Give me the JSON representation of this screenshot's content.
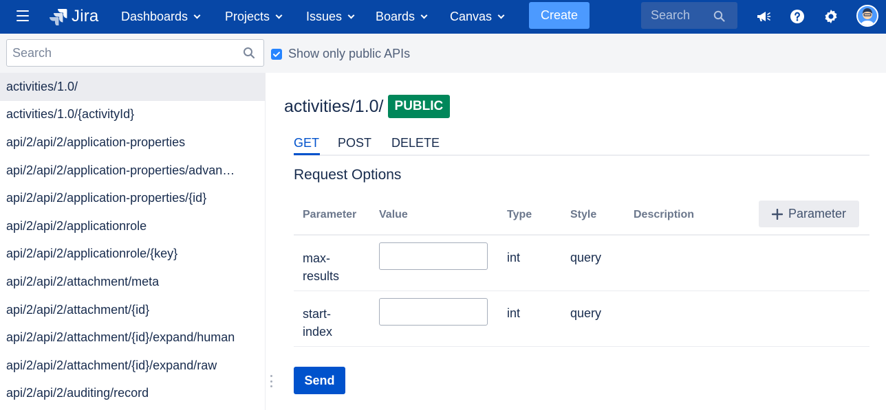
{
  "topnav": {
    "app_name": "Jira",
    "items": [
      {
        "label": "Dashboards"
      },
      {
        "label": "Projects"
      },
      {
        "label": "Issues"
      },
      {
        "label": "Boards"
      },
      {
        "label": "Canvas"
      }
    ],
    "create_label": "Create",
    "search_placeholder": "Search",
    "icons": [
      "menu-icon",
      "jira-logo-icon",
      "megaphone-icon",
      "help-icon",
      "settings-icon",
      "avatar"
    ],
    "colors": {
      "bar": "#0747a6",
      "create": "#4c9aff"
    }
  },
  "subbar": {
    "search_placeholder": "Search",
    "checkbox_label": "Show only public APIs",
    "checkbox_checked": true
  },
  "sidebar": {
    "items": [
      {
        "label": "activities/1.0/"
      },
      {
        "label": "activities/1.0/{activityId}"
      },
      {
        "label": "api/2/api/2/application-properties"
      },
      {
        "label": "api/2/api/2/application-properties/advan…"
      },
      {
        "label": "api/2/api/2/application-properties/{id}"
      },
      {
        "label": "api/2/api/2/applicationrole"
      },
      {
        "label": "api/2/api/2/applicationrole/{key}"
      },
      {
        "label": "api/2/api/2/attachment/meta"
      },
      {
        "label": "api/2/api/2/attachment/{id}"
      },
      {
        "label": "api/2/api/2/attachment/{id}/expand/human"
      },
      {
        "label": "api/2/api/2/attachment/{id}/expand/raw"
      },
      {
        "label": "api/2/api/2/auditing/record"
      }
    ],
    "active_index": 0
  },
  "main": {
    "title": "activities/1.0/",
    "badge": "PUBLIC",
    "badge_color": "#00875a",
    "tabs": [
      {
        "label": "GET"
      },
      {
        "label": "POST"
      },
      {
        "label": "DELETE"
      }
    ],
    "active_tab": 0,
    "section_title": "Request Options",
    "table": {
      "headers": [
        "Parameter",
        "Value",
        "Type",
        "Style",
        "Description"
      ],
      "add_parameter_label": "Parameter",
      "rows": [
        {
          "name": "max-results",
          "value": "",
          "type": "int",
          "style": "query"
        },
        {
          "name": "start-index",
          "value": "",
          "type": "int",
          "style": "query"
        }
      ]
    },
    "send_label": "Send"
  }
}
